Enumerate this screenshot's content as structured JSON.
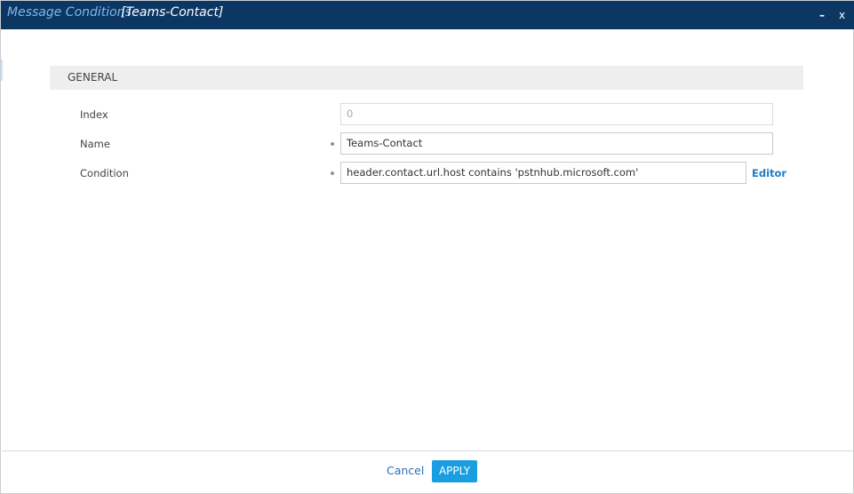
{
  "window": {
    "title": "Message Conditions",
    "record": "[Teams-Contact]",
    "minimize_label": "–",
    "close_label": "x"
  },
  "section": {
    "title": "GENERAL"
  },
  "fields": {
    "index": {
      "label": "Index",
      "value": "0"
    },
    "name": {
      "label": "Name",
      "value": "Teams-Contact"
    },
    "condition": {
      "label": "Condition",
      "value": "header.contact.url.host contains 'pstnhub.microsoft.com'",
      "editor_label": "Editor"
    }
  },
  "footer": {
    "cancel_label": "Cancel",
    "apply_label": "APPLY"
  },
  "colors": {
    "titlebar": "#0c3763",
    "title_accent": "#7fb7ee",
    "link": "#1e7cc8",
    "primary_button": "#1a9ee2"
  }
}
